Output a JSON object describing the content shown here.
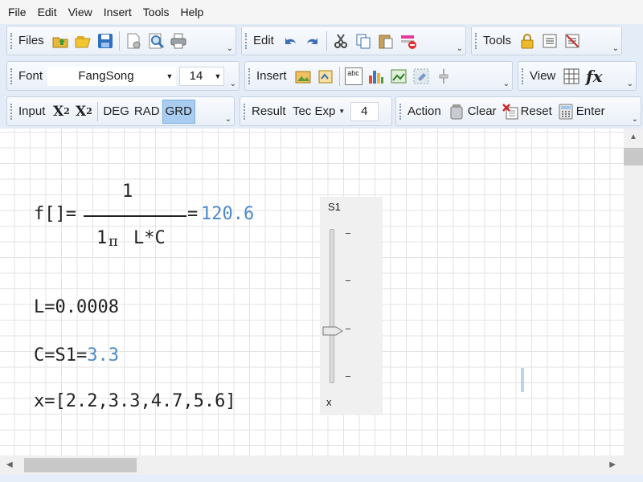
{
  "menu": [
    "File",
    "Edit",
    "View",
    "Insert",
    "Tools",
    "Help"
  ],
  "toolbar": {
    "files_label": "Files",
    "edit_label": "Edit",
    "tools_label": "Tools",
    "font_label": "Font",
    "font_name": "FangSong",
    "font_size": "14",
    "insert_label": "Insert",
    "view_label": "View",
    "fx_label": "fx",
    "input_label": "Input",
    "x_super_base": "X",
    "x_super_exp": "2",
    "x_sub_base": "X",
    "x_sub_idx": "2",
    "deg": "DEG",
    "rad": "RAD",
    "grd": "GRD",
    "result_label": "Result",
    "format_value": "Tec Exp",
    "precision": "4",
    "action_label": "Action",
    "clear_label": "Clear",
    "reset_label": "Reset",
    "enter_label": "Enter",
    "abc_label": "abc"
  },
  "worksheet": {
    "f_lhs": "f[]=",
    "f_numerator": "1",
    "f_denom_a": "1",
    "f_denom_pi": "π",
    "f_denom_b": "L*C",
    "f_equals": "=",
    "f_result": "120.6",
    "L_expr": "L=0.0008",
    "C_expr": "C=S1=",
    "C_result": "3.3",
    "x_expr": "x=[2.2,3.3,4.7,5.6]"
  },
  "slider": {
    "name": "S1",
    "variable": "x",
    "value_fraction": 0.33
  },
  "colors": {
    "result_blue": "#4d8ac8",
    "grid_line": "#e3e3e3",
    "toolbar_bg": "#e4ecf7",
    "active_button": "#a8cdf0"
  }
}
